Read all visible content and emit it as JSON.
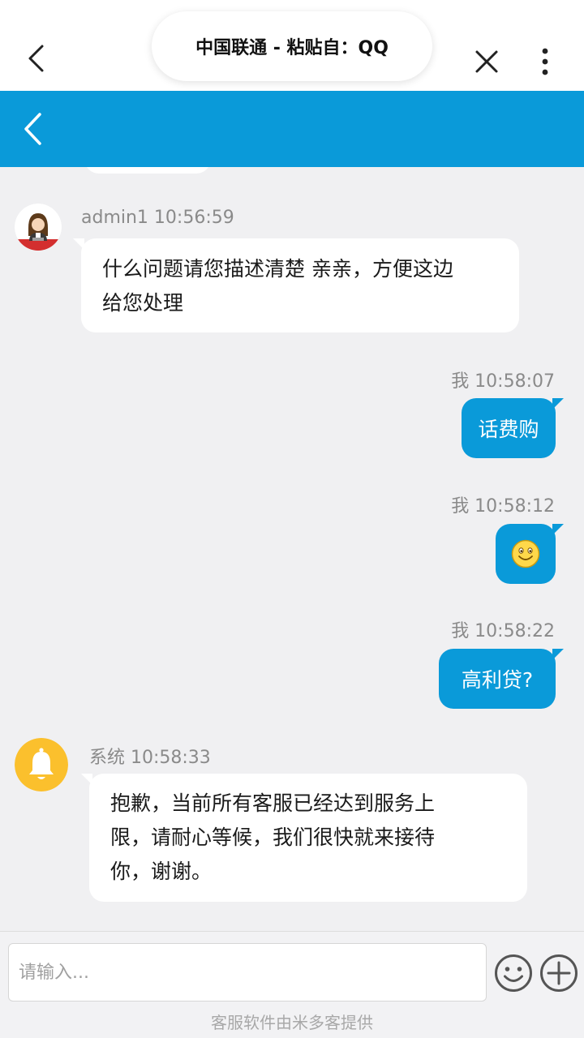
{
  "header": {
    "title": "中国联通 - 粘贴自：QQ"
  },
  "colors": {
    "accent": "#0a9ad9",
    "background": "#f0f0f2",
    "bubble_in": "#ffffff",
    "bell": "#fbc02d"
  },
  "messages": [
    {
      "sender": "admin1",
      "time": "10:56:59",
      "meta": "admin1 10:56:59",
      "direction": "in",
      "avatar_icon": "agent-avatar-icon",
      "lines": [
        "什么问题请您描述清楚 亲亲，方便这边",
        "给您处理"
      ]
    },
    {
      "sender": "我",
      "time": "10:58:07",
      "meta": "我 10:58:07",
      "direction": "out",
      "text": "话费购"
    },
    {
      "sender": "我",
      "time": "10:58:12",
      "meta": "我 10:58:12",
      "direction": "out",
      "emoji": "smile-emoji-icon"
    },
    {
      "sender": "我",
      "time": "10:58:22",
      "meta": "我 10:58:22",
      "direction": "out",
      "text": "高利贷?"
    },
    {
      "sender": "系统",
      "time": "10:58:33",
      "meta": "系统 10:58:33",
      "direction": "in",
      "avatar_icon": "bell-icon",
      "lines": [
        "抱歉，当前所有客服已经达到服务上",
        "限，请耐心等候，我们很快就来接待",
        "你，谢谢。"
      ]
    }
  ],
  "composer": {
    "placeholder": "请输入...",
    "value": "",
    "emoji_button_icon": "smiley-icon",
    "add_button_icon": "plus-circle-icon"
  },
  "footer": {
    "note": "客服软件由米多客提供"
  }
}
